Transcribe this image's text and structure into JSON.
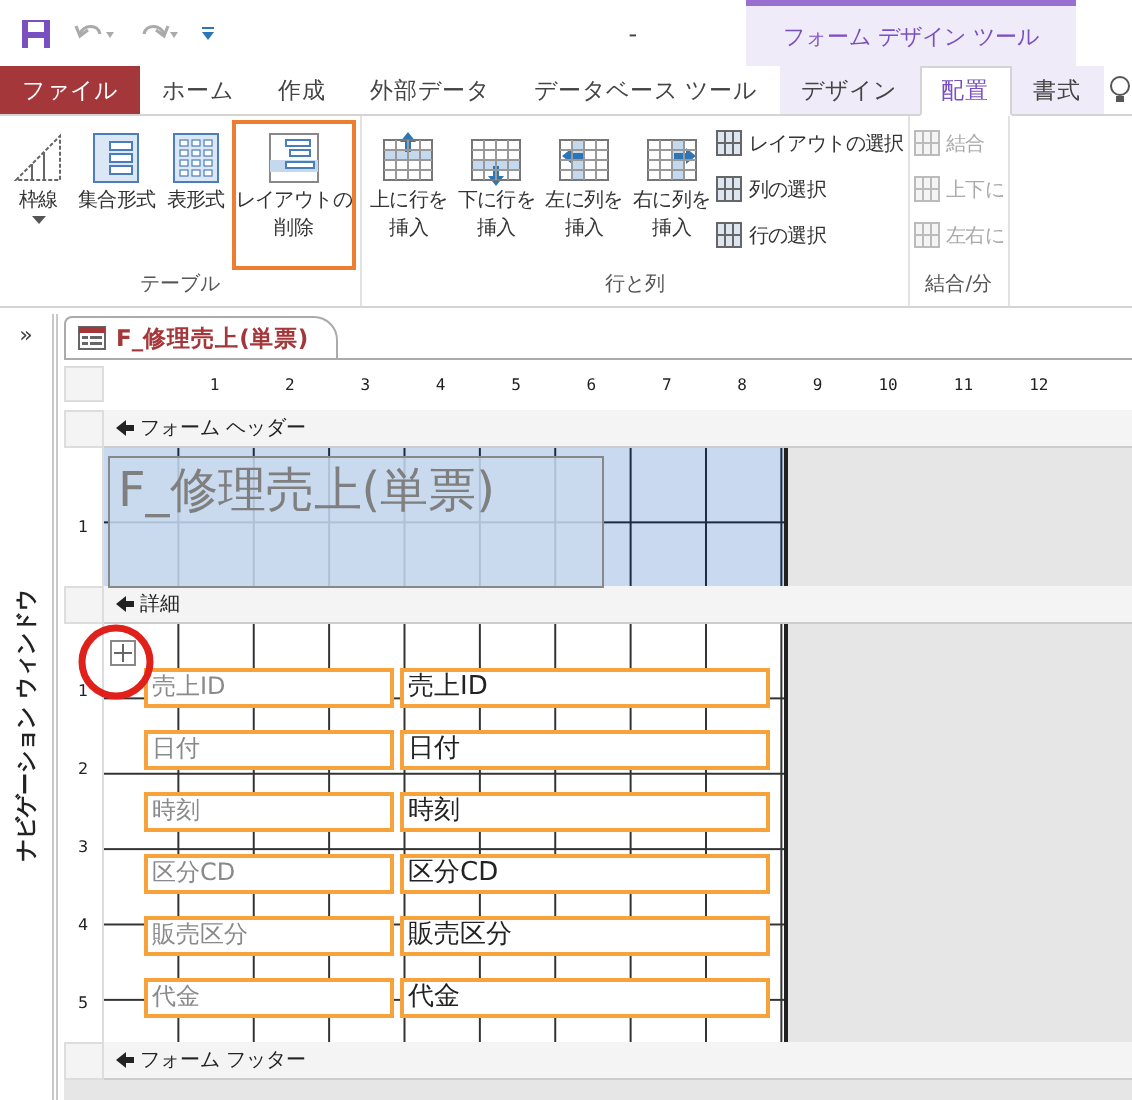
{
  "title_bar": {
    "separator": "-",
    "context_tool": "フォーム デザイン ツール"
  },
  "ribbon_tabs": [
    {
      "label": "ファイル",
      "kind": "file",
      "selected": false
    },
    {
      "label": "ホーム",
      "kind": "normal",
      "selected": false
    },
    {
      "label": "作成",
      "kind": "normal",
      "selected": false
    },
    {
      "label": "外部データ",
      "kind": "normal",
      "selected": false
    },
    {
      "label": "データベース ツール",
      "kind": "normal",
      "selected": false
    },
    {
      "label": "デザイン",
      "kind": "context",
      "selected": false
    },
    {
      "label": "配置",
      "kind": "context",
      "selected": true
    },
    {
      "label": "書式",
      "kind": "context",
      "selected": false
    }
  ],
  "ribbon_groups": [
    {
      "label": "テーブル",
      "large": [
        {
          "lines": [
            "枠線"
          ],
          "dropdown": true,
          "highlighted": false
        },
        {
          "lines": [
            "集合形式"
          ],
          "dropdown": false,
          "highlighted": false
        },
        {
          "lines": [
            "表形式"
          ],
          "dropdown": false,
          "highlighted": false
        },
        {
          "lines": [
            "レイアウトの",
            "削除"
          ],
          "dropdown": false,
          "highlighted": true
        }
      ]
    },
    {
      "label": "行と列",
      "large": [
        {
          "lines": [
            "上に行を",
            "挿入"
          ],
          "dropdown": false,
          "highlighted": false
        },
        {
          "lines": [
            "下に行を",
            "挿入"
          ],
          "dropdown": false,
          "highlighted": false
        },
        {
          "lines": [
            "左に列を",
            "挿入"
          ],
          "dropdown": false,
          "highlighted": false
        },
        {
          "lines": [
            "右に列を",
            "挿入"
          ],
          "dropdown": false,
          "highlighted": false
        }
      ],
      "small": [
        {
          "label": "レイアウトの選択",
          "disabled": false
        },
        {
          "label": "列の選択",
          "disabled": false
        },
        {
          "label": "行の選択",
          "disabled": false
        }
      ]
    },
    {
      "label": "結合/分",
      "small": [
        {
          "label": "結合",
          "disabled": true
        },
        {
          "label": "上下に",
          "disabled": true
        },
        {
          "label": "左右に",
          "disabled": true
        }
      ]
    }
  ],
  "nav_pane": {
    "expand": "»",
    "label": "ナビゲーション ウィンドウ"
  },
  "document_tab": "F_修理売上(単票)",
  "ruler": [
    "1",
    "2",
    "3",
    "4",
    "5",
    "6",
    "7",
    "8",
    "9",
    "10",
    "11",
    "12"
  ],
  "sections": [
    {
      "kind": "header",
      "label": "フォーム ヘッダー",
      "vertical_ruler": [
        "1"
      ],
      "title": "F_修理売上(単票)"
    },
    {
      "kind": "detail",
      "label": "詳細",
      "vertical_ruler": [
        "1",
        "2",
        "3",
        "4",
        "5"
      ],
      "fields": [
        {
          "label": "売上ID",
          "value": "売上ID"
        },
        {
          "label": "日付",
          "value": "日付"
        },
        {
          "label": "時刻",
          "value": "時刻"
        },
        {
          "label": "区分CD",
          "value": "区分CD"
        },
        {
          "label": "販売区分",
          "value": "販売区分"
        },
        {
          "label": "代金",
          "value": "代金"
        }
      ]
    },
    {
      "kind": "footer",
      "label": "フォーム フッター"
    }
  ]
}
